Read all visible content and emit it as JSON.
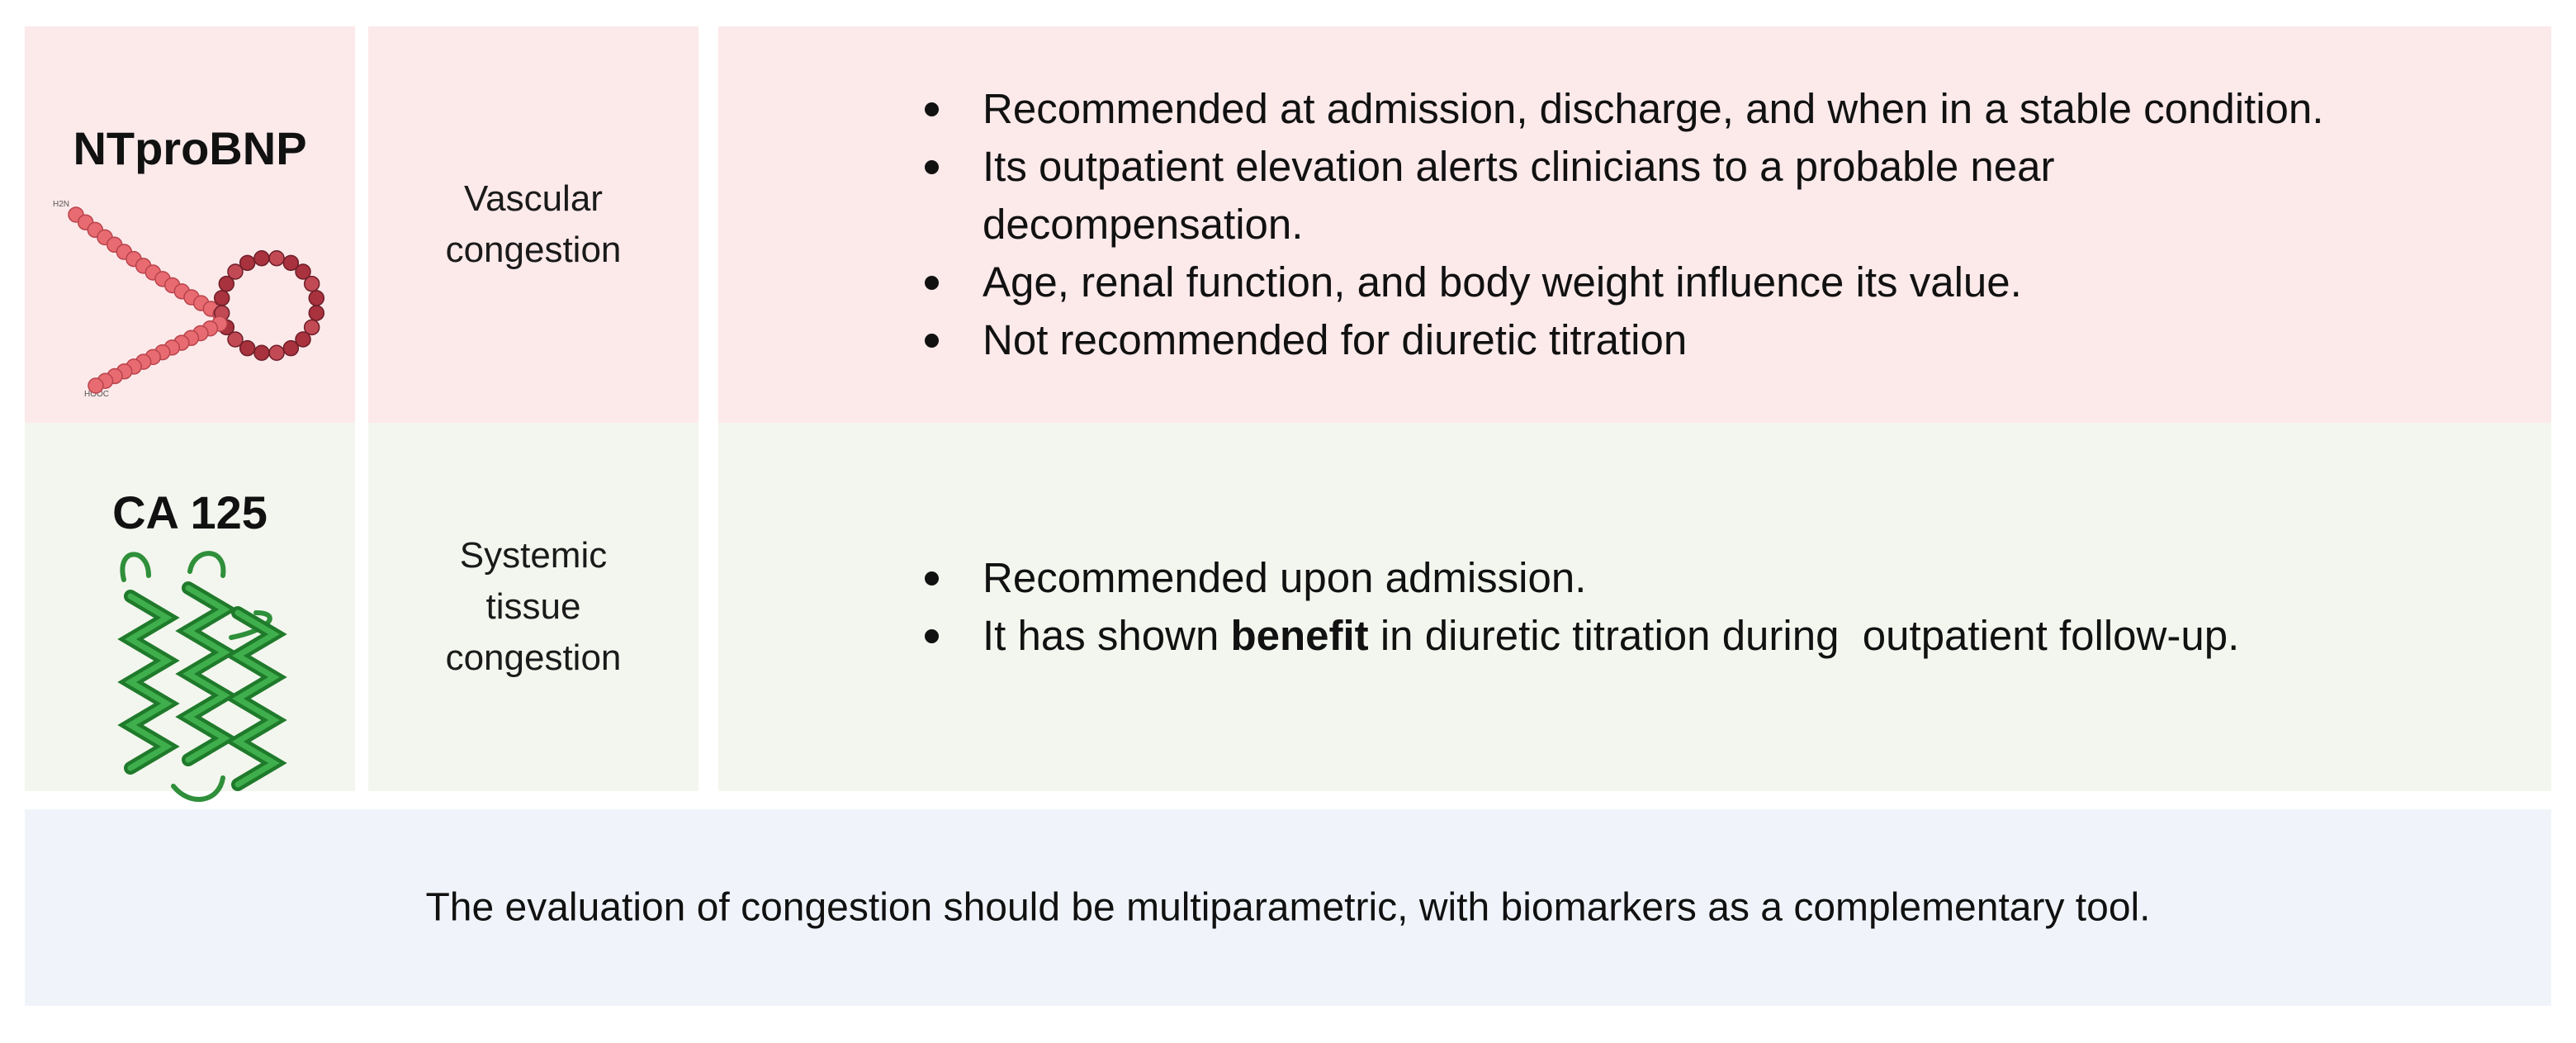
{
  "rows": [
    {
      "marker": "NTproBNP",
      "congestion": [
        "Vascular",
        "congestion"
      ],
      "bullets": [
        "Recommended at admission, discharge, and when in a stable condition.",
        "Its outpatient elevation alerts clinicians to a probable near decompensation.",
        "Age, renal function, and body weight influence its value.",
        "Not recommended for diuretic titration"
      ],
      "image_labels": {
        "n_term": "H2N",
        "c_term": "HOOC"
      },
      "icon": "peptide-chain-icon",
      "color": "#fce9ea"
    },
    {
      "marker": "CA 125",
      "congestion": [
        "Systemic",
        "tissue",
        "congestion"
      ],
      "bullets": [
        "Recommended upon admission.",
        {
          "pre": "It has shown ",
          "bold": "benefit",
          "post": " in diuretic titration during  outpatient follow-up."
        }
      ],
      "icon": "protein-helix-icon",
      "color": "#f3f6ee"
    }
  ],
  "footer": {
    "text": "The evaluation of congestion should be multiparametric, with biomarkers as a complementary tool.",
    "color": "#f0f4fa"
  }
}
